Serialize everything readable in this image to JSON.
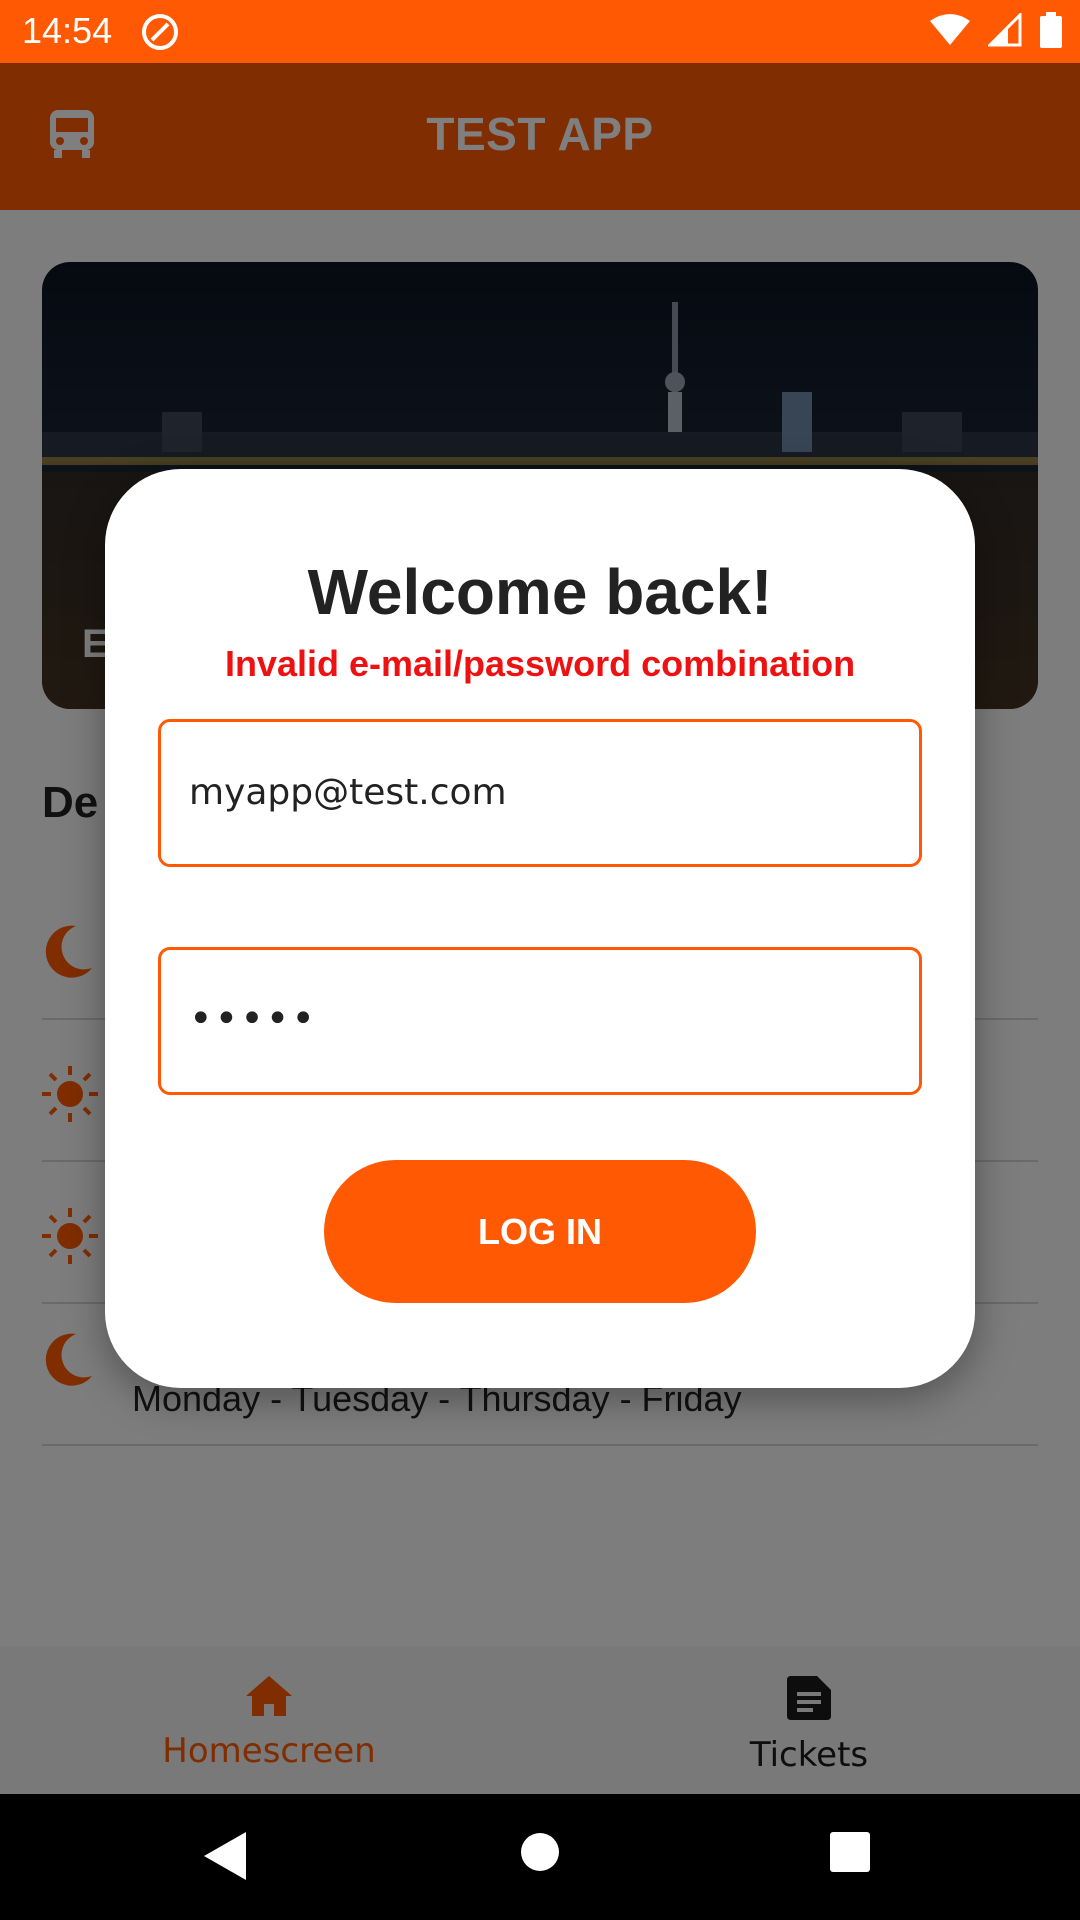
{
  "status_bar": {
    "time": "14:54"
  },
  "app_bar": {
    "title": "TEST APP",
    "icon": "bus-icon"
  },
  "hero": {
    "title": "E"
  },
  "section": {
    "title": "De"
  },
  "rows": [
    {
      "icon": "moon-icon",
      "text": ""
    },
    {
      "icon": "sun-icon",
      "text": ""
    },
    {
      "icon": "sun-icon",
      "text": ""
    },
    {
      "icon": "moon-icon",
      "text": "Monday - Tuesday - Thursday - Friday"
    }
  ],
  "bottom_nav": {
    "home_label": "Homescreen",
    "tickets_label": "Tickets"
  },
  "dialog": {
    "title": "Welcome back!",
    "error": "Invalid e-mail/password combination",
    "email_value": "myapp@test.com",
    "password_value": "•••••",
    "login_label": "LOG IN"
  },
  "colors": {
    "accent": "#ff5a03",
    "error": "#ee1111"
  }
}
